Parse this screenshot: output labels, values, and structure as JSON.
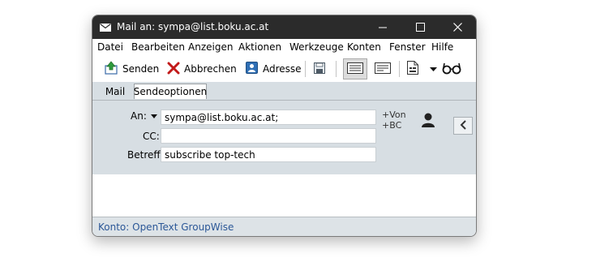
{
  "window": {
    "title": "Mail an: sympa@list.boku.ac.at"
  },
  "menu": [
    "Datei",
    "Bearbeiten",
    "Anzeigen",
    "Aktionen",
    "Werkzeuge",
    "Konten",
    "Fenster",
    "Hilfe"
  ],
  "toolbar": {
    "send_label": "Senden",
    "cancel_label": "Abbrechen",
    "address_label": "Adresse"
  },
  "tabs": {
    "mail": "Mail",
    "send_options": "Sendeoptionen"
  },
  "form": {
    "to_label": "An:",
    "to_value": "sympa@list.boku.ac.at;",
    "cc_label": "CC:",
    "cc_value": "",
    "subject_label": "Betreff:",
    "subject_value": "subscribe top-tech",
    "add_from": "Von",
    "add_bc": "BC"
  },
  "status": {
    "account": "Konto: OpenText GroupWise"
  },
  "colors": {
    "titlebar": "#2b2b2b",
    "header_bg": "#d7dee3",
    "status_text": "#2b5797",
    "cancel_red": "#c21a1a"
  }
}
